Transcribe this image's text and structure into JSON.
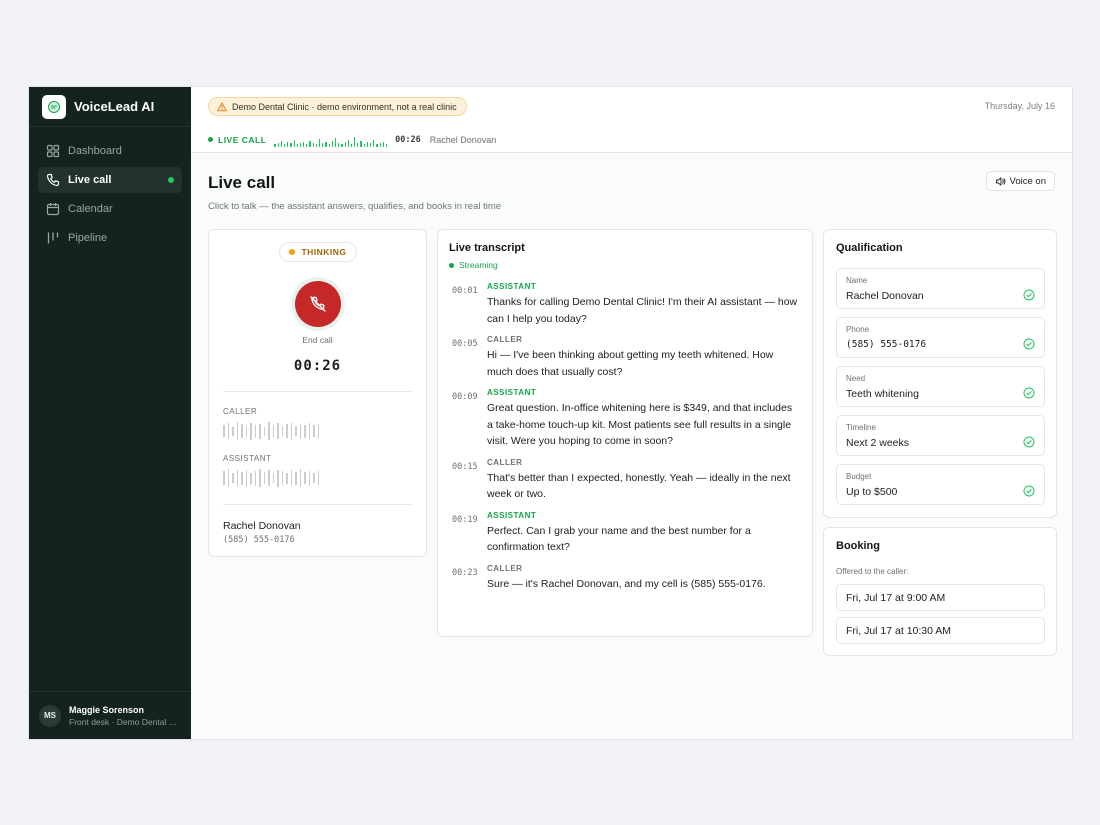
{
  "brand": {
    "name": "VoiceLead AI"
  },
  "sidebar": {
    "items": [
      {
        "label": "Dashboard",
        "icon": "grid-icon"
      },
      {
        "label": "Live call",
        "icon": "phone-icon",
        "active": true
      },
      {
        "label": "Calendar",
        "icon": "calendar-icon"
      },
      {
        "label": "Pipeline",
        "icon": "pipeline-icon"
      }
    ],
    "user": {
      "initials": "MS",
      "name": "Maggie Sorenson",
      "role": "Front desk · Demo Dental Clinic"
    }
  },
  "topbar": {
    "demo_notice": "Demo Dental Clinic · demo environment, not a real clinic",
    "date": "Thursday, July 16"
  },
  "livebar": {
    "label": "LIVE CALL",
    "timer": "00:26",
    "caller": "Rachel Donovan"
  },
  "page": {
    "title": "Live call",
    "subtitle": "Click to talk — the assistant answers, qualifies, and books in real time",
    "voice_button": "Voice on"
  },
  "call": {
    "status": "THINKING",
    "end_label": "End call",
    "timer": "00:26",
    "caller_label": "CALLER",
    "assistant_label": "ASSISTANT",
    "caller_name": "Rachel Donovan",
    "caller_phone": "(585) 555-0176"
  },
  "transcript": {
    "title": "Live transcript",
    "status": "Streaming",
    "messages": [
      {
        "time": "00:01",
        "role": "ASSISTANT",
        "text": "Thanks for calling Demo Dental Clinic! I'm their AI assistant — how can I help you today?"
      },
      {
        "time": "00:05",
        "role": "CALLER",
        "text": "Hi — I've been thinking about getting my teeth whitened. How much does that usually cost?"
      },
      {
        "time": "00:09",
        "role": "ASSISTANT",
        "text": "Great question. In-office whitening here is $349, and that includes a take-home touch-up kit. Most patients see full results in a single visit. Were you hoping to come in soon?"
      },
      {
        "time": "00:15",
        "role": "CALLER",
        "text": "That's better than I expected, honestly. Yeah — ideally in the next week or two."
      },
      {
        "time": "00:19",
        "role": "ASSISTANT",
        "text": "Perfect. Can I grab your name and the best number for a confirmation text?"
      },
      {
        "time": "00:23",
        "role": "CALLER",
        "text": "Sure — it's Rachel Donovan, and my cell is (585) 555-0176."
      }
    ]
  },
  "qualification": {
    "title": "Qualification",
    "fields": [
      {
        "label": "Name",
        "value": "Rachel Donovan"
      },
      {
        "label": "Phone",
        "value": "(585) 555-0176"
      },
      {
        "label": "Need",
        "value": "Teeth whitening"
      },
      {
        "label": "Timeline",
        "value": "Next 2 weeks"
      },
      {
        "label": "Budget",
        "value": "Up to $500"
      }
    ]
  },
  "booking": {
    "title": "Booking",
    "subtitle": "Offered to the caller:",
    "slots": [
      "Fri, Jul 17 at 9:00 AM",
      "Fri, Jul 17 at 10:30 AM"
    ]
  },
  "colors": {
    "sidebar": "#142320",
    "accent": "#16a34a",
    "end_call": "#c62828",
    "warning": "#f59e0b"
  }
}
